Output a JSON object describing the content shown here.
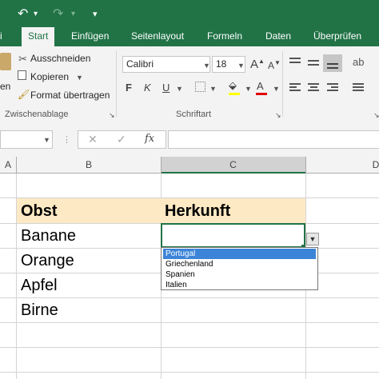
{
  "qat": {
    "undo_icon": "undo-icon",
    "redo_icon": "redo-icon",
    "customize_icon": "customize-icon"
  },
  "tabs": [
    {
      "label": "i",
      "active": false
    },
    {
      "label": "Start",
      "active": true
    },
    {
      "label": "Einfügen",
      "active": false
    },
    {
      "label": "Seitenlayout",
      "active": false
    },
    {
      "label": "Formeln",
      "active": false
    },
    {
      "label": "Daten",
      "active": false
    },
    {
      "label": "Überprüfen",
      "active": false
    }
  ],
  "clipboard": {
    "paste_label_partial": "en",
    "cut": "Ausschneiden",
    "copy": "Kopieren",
    "format_painter": "Format übertragen",
    "group_label": "Zwischenablage"
  },
  "font": {
    "name": "Calibri",
    "size": "18",
    "bold": "F",
    "italic": "K",
    "underline": "U",
    "grow": "A",
    "shrink": "A",
    "font_color_glyph": "A",
    "group_label": "Schriftart"
  },
  "formula_bar": {
    "cancel": "✕",
    "enter": "✓",
    "fx": "fx",
    "value": ""
  },
  "columns": [
    "A",
    "B",
    "C",
    "D"
  ],
  "table": {
    "headers": [
      "Obst",
      "Herkunft"
    ],
    "rows": [
      "Banane",
      "Orange",
      "Apfel",
      "Birne"
    ]
  },
  "dropdown": {
    "options": [
      "Portugal",
      "Griechenland",
      "Spanien",
      "Italien"
    ],
    "selected_index": 0
  },
  "colors": {
    "accent": "#217346",
    "header_fill": "#fde9c4",
    "selection": "#3c84d8"
  }
}
